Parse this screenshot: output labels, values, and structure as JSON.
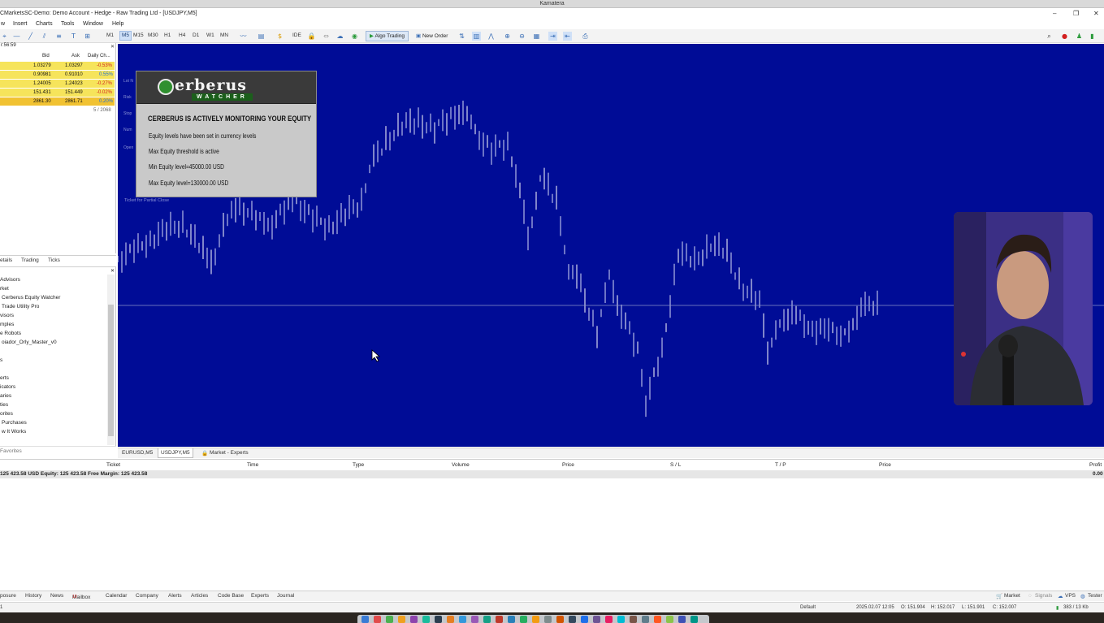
{
  "host": {
    "title": "Kamatera"
  },
  "window": {
    "title": "CMarketsSC-Demo: Demo Account - Hedge - Raw Trading Ltd - [USDJPY,M5]"
  },
  "menu": [
    "Insert",
    "Charts",
    "Tools",
    "Window",
    "Help"
  ],
  "menu_first": "w",
  "toolbar": {
    "timeframes": [
      "M1",
      "M5",
      "M15",
      "M30",
      "H1",
      "H4",
      "D1",
      "W1",
      "MN"
    ],
    "selected_timeframe": "M5",
    "ide_label": "IDE",
    "algo_trading": "Algo Trading",
    "new_order": "New Order"
  },
  "market_watch": {
    "time": "r:56:59",
    "columns": [
      "Bid",
      "Ask",
      "Daily Ch..."
    ],
    "rows": [
      {
        "bid": "1.03279",
        "ask": "1.03297",
        "change": "-0.53%",
        "dir": "neg"
      },
      {
        "bid": "0.90981",
        "ask": "0.91010",
        "change": "0.55%",
        "dir": "pos"
      },
      {
        "bid": "1.24005",
        "ask": "1.24023",
        "change": "-0.27%",
        "dir": "neg"
      },
      {
        "bid": "151.431",
        "ask": "151.449",
        "change": "-0.02%",
        "dir": "neg"
      },
      {
        "bid": "2861.30",
        "ask": "2861.71",
        "change": "0.20%",
        "dir": "pos"
      }
    ],
    "count": "5 / 2068",
    "tabs": [
      "etails",
      "Trading",
      "Ticks"
    ]
  },
  "navigator": {
    "items": [
      "Advisors",
      "rket",
      "Cerberus Equity Watcher",
      "Trade Utility Pro",
      "visors",
      "mples",
      "e Robots",
      "oiador_Orly_Master_v0",
      "s",
      "",
      "erts",
      "icators",
      "aries",
      "ties",
      "orites",
      "Purchases",
      "w It Works"
    ],
    "favorites": "Favorites"
  },
  "chart": {
    "ticket_label": "Ticket for Partial Close",
    "side_labels": [
      "Lot N",
      "Risk",
      "Stop",
      "Num",
      "Open"
    ]
  },
  "cerberus": {
    "brand": "erberus",
    "sub": "WATCHER",
    "heading": "CERBERUS IS ACTIVELY MONITORING YOUR EQUITY",
    "lines": [
      "Equity levels have been set in currency levels",
      "Max Equity threshold is active",
      "Min Equity level=45000.00 USD",
      "Max Equity level=130000.00 USD"
    ]
  },
  "chart_tabs": [
    "EURUSD,M5",
    "USDJPY,M5",
    "Market - Experts"
  ],
  "terminal": {
    "columns": [
      "Ticket",
      "Time",
      "Type",
      "Volume",
      "Price",
      "S / L",
      "T / P",
      "Price",
      "Profit"
    ],
    "balance_line": "125 423.58 USD  Equity: 125 423.58  Free Margin: 125 423.58",
    "profit_total": "0.00"
  },
  "bottom_tabs": [
    "posure",
    "History",
    "News",
    "Mailbox",
    "Calendar",
    "Company",
    "Alerts",
    "Articles",
    "Code Base",
    "Experts",
    "Journal"
  ],
  "mailbox_badge": "10",
  "status": {
    "right_tabs": [
      "Market",
      "Signals",
      "VPS",
      "Tester"
    ],
    "left": "1",
    "profile": "Default",
    "datetime": "2025.02.07 12:05",
    "open": "O: 151.904",
    "high": "H: 152.017",
    "low": "L: 151.901",
    "close": "C: 152.007",
    "traffic": "383 / 13 Kb"
  }
}
